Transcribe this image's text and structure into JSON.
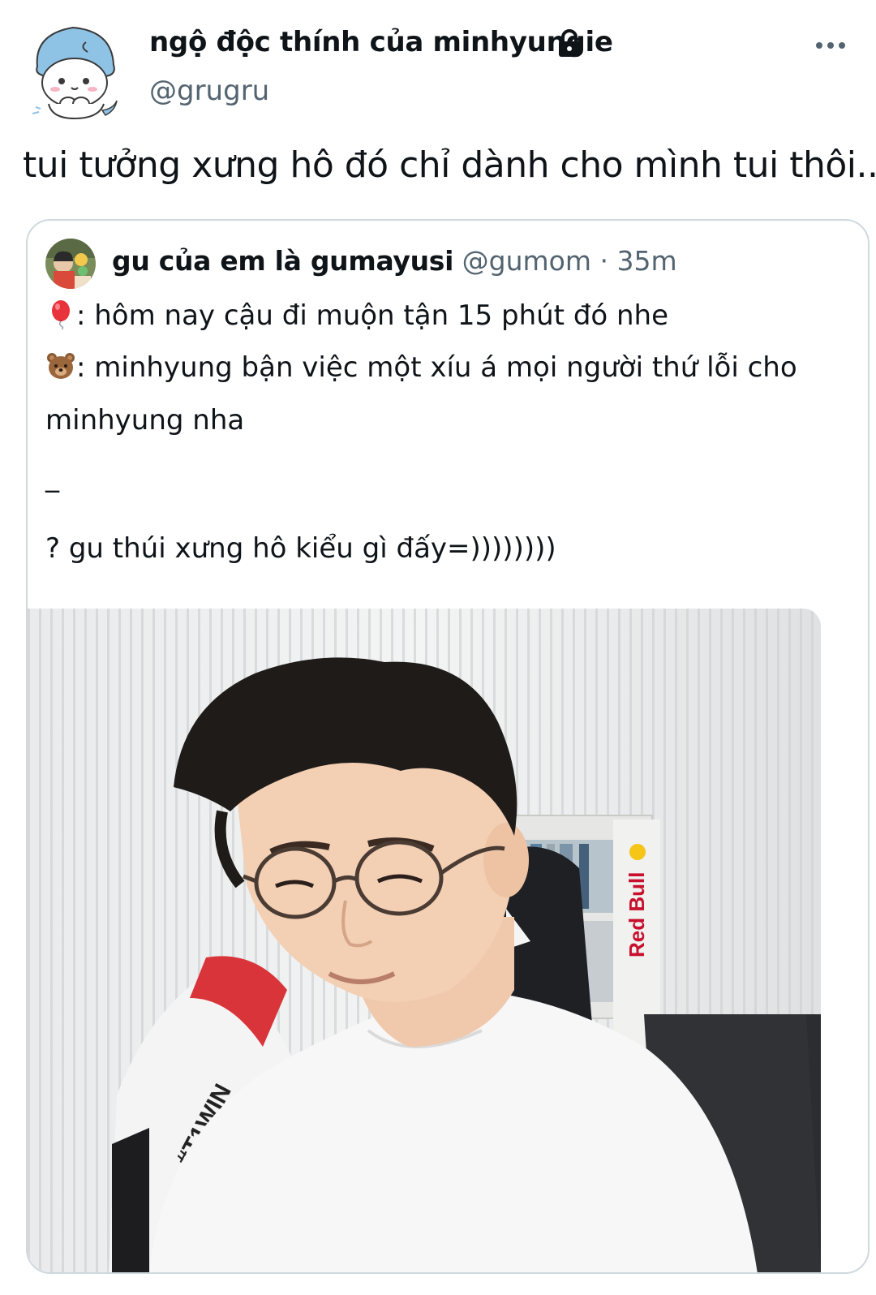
{
  "tweet": {
    "display_name": "ngộ độc thính của minhyungie",
    "handle": "@grugru",
    "text": "tui tưởng xưng hô đó chỉ dành cho mình tui thôi..."
  },
  "quoted_tweet": {
    "display_name": "gu của em là gumayusi",
    "handle": "@gumom",
    "separator": " · ",
    "time": "35m",
    "lines": {
      "line1": ": hôm nay cậu đi muộn tận 15 phút đó nhe",
      "line2": ": minhyung bận việc một xíu á mọi người thứ lỗi cho",
      "line3": "minhyung nha",
      "line4": "_",
      "line5": "? gu thúi xưng hô kiểu gì đấy=))))))))"
    },
    "photo_texts": {
      "jersey": "#T1WIN",
      "sponsor": "Red Bull"
    }
  },
  "icons": {
    "lock": "lock-icon",
    "more": "more-icon",
    "balloon": "balloon-emoji",
    "bear": "bear-emoji"
  },
  "colors": {
    "text_primary": "#0f1419",
    "text_secondary": "#536471",
    "border": "#cfd9de"
  }
}
